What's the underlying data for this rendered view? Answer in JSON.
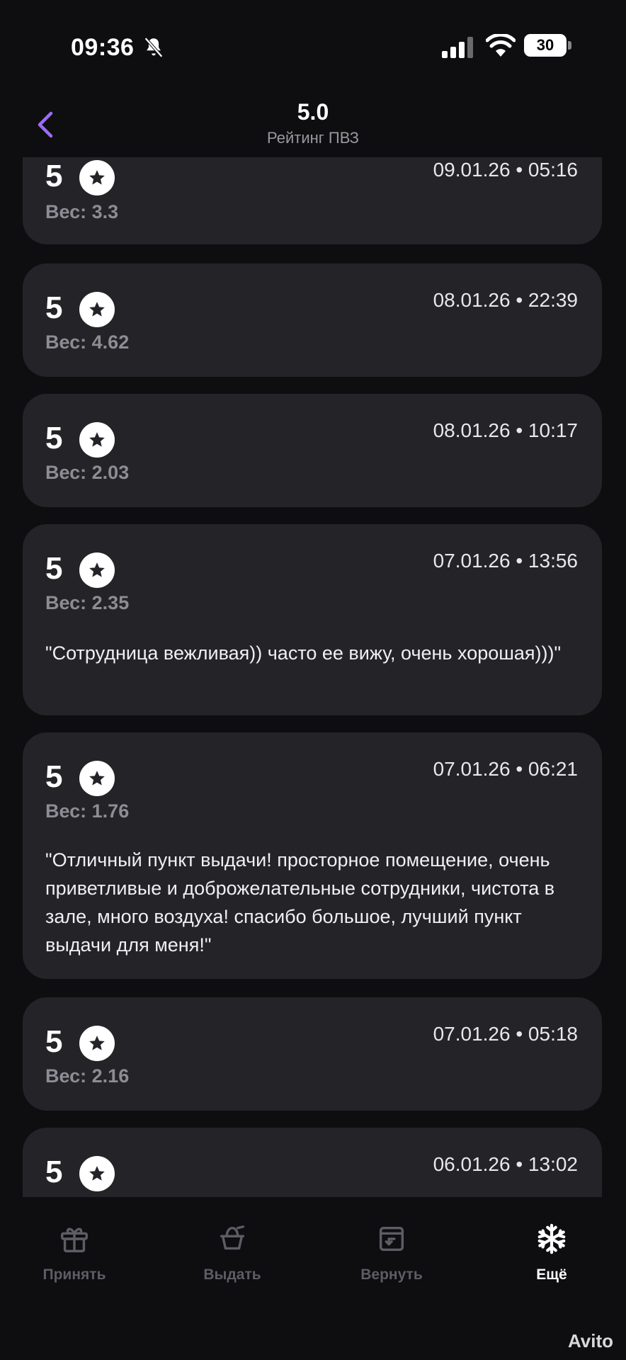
{
  "status_bar": {
    "time": "09:36",
    "battery": "30"
  },
  "header": {
    "title": "5.0",
    "subtitle": "Рейтинг ПВЗ"
  },
  "reviews": [
    {
      "rating": "5",
      "date": "09.01.26 • 05:16",
      "weight": "Вес: 3.3",
      "comment": ""
    },
    {
      "rating": "5",
      "date": "08.01.26 • 22:39",
      "weight": "Вес: 4.62",
      "comment": ""
    },
    {
      "rating": "5",
      "date": "08.01.26 • 10:17",
      "weight": "Вес: 2.03",
      "comment": ""
    },
    {
      "rating": "5",
      "date": "07.01.26 • 13:56",
      "weight": "Вес: 2.35",
      "comment": "\"Сотрудница вежливая)) часто ее вижу, очень хорошая)))\""
    },
    {
      "rating": "5",
      "date": "07.01.26 • 06:21",
      "weight": "Вес: 1.76",
      "comment": "\"Отличный пункт выдачи! просторное помещение, очень приветливые и доброжелательные сотрудники, чистота в зале, много воздуха! спасибо большое, лучший пункт выдачи для меня!\""
    },
    {
      "rating": "5",
      "date": "07.01.26 • 05:18",
      "weight": "Вес: 2.16",
      "comment": ""
    },
    {
      "rating": "5",
      "date": "06.01.26 • 13:02",
      "weight": "",
      "comment": ""
    }
  ],
  "bottom_nav": [
    {
      "label": "Принять",
      "icon": "gift-icon",
      "active": false
    },
    {
      "label": "Выдать",
      "icon": "handover-icon",
      "active": false
    },
    {
      "label": "Вернуть",
      "icon": "return-box-icon",
      "active": false
    },
    {
      "label": "Ещё",
      "icon": "snowflake-icon",
      "active": true
    }
  ],
  "watermark": "Avito",
  "colors": {
    "background": "#0e0d10",
    "card": "#242327",
    "accent": "#9b6cf2",
    "muted": "#8e8c94"
  }
}
